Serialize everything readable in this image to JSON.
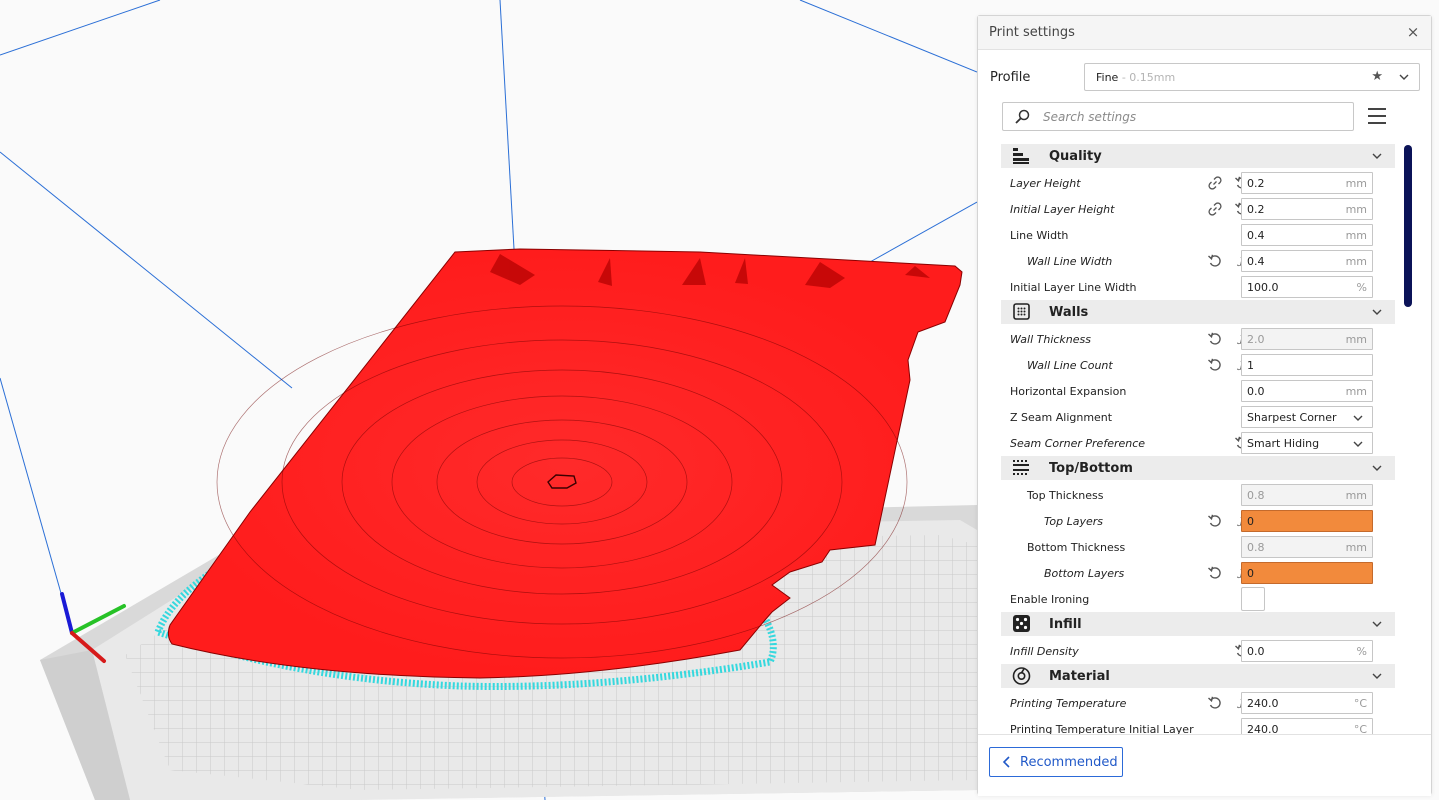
{
  "panel": {
    "title": "Print settings",
    "close_glyph": "×",
    "profile_label": "Profile",
    "profile_name": "Fine",
    "profile_detail": " - 0.15mm",
    "search_placeholder": "Search settings",
    "footer_button": "Recommended"
  },
  "icons": {
    "quality": "quality-icon",
    "walls": "walls-icon",
    "top_bottom": "top-bottom-icon",
    "infill": "infill-icon",
    "material": "material-icon",
    "link": "link-icon",
    "reset": "reset-icon",
    "function": "function-icon"
  },
  "categories": {
    "quality": "Quality",
    "walls": "Walls",
    "top_bottom": "Top/Bottom",
    "infill": "Infill",
    "material": "Material"
  },
  "settings": {
    "layer_height": {
      "label": "Layer Height",
      "value": "0.2",
      "unit": "mm"
    },
    "initial_layer_height": {
      "label": "Initial Layer Height",
      "value": "0.2",
      "unit": "mm"
    },
    "line_width": {
      "label": "Line Width",
      "value": "0.4",
      "unit": "mm"
    },
    "wall_line_width": {
      "label": "Wall Line Width",
      "value": "0.4",
      "unit": "mm"
    },
    "initial_layer_line_width": {
      "label": "Initial Layer Line Width",
      "value": "100.0",
      "unit": "%"
    },
    "wall_thickness": {
      "label": "Wall Thickness",
      "value": "2.0",
      "unit": "mm"
    },
    "wall_line_count": {
      "label": "Wall Line Count",
      "value": "1"
    },
    "horizontal_expansion": {
      "label": "Horizontal Expansion",
      "value": "0.0",
      "unit": "mm"
    },
    "z_seam_alignment": {
      "label": "Z Seam Alignment",
      "value": "Sharpest Corner"
    },
    "seam_corner_preference": {
      "label": "Seam Corner Preference",
      "value": "Smart Hiding"
    },
    "top_thickness": {
      "label": "Top Thickness",
      "value": "0.8",
      "unit": "mm"
    },
    "top_layers": {
      "label": "Top Layers",
      "value": "0"
    },
    "bottom_thickness": {
      "label": "Bottom Thickness",
      "value": "0.8",
      "unit": "mm"
    },
    "bottom_layers": {
      "label": "Bottom Layers",
      "value": "0"
    },
    "enable_ironing": {
      "label": "Enable Ironing",
      "checked": false
    },
    "infill_density": {
      "label": "Infill Density",
      "value": "0.0",
      "unit": "%"
    },
    "printing_temperature": {
      "label": "Printing Temperature",
      "value": "240.0",
      "unit": "°C"
    },
    "printing_temperature_initial_layer": {
      "label": "Printing Temperature Initial Layer",
      "value": "240.0",
      "unit": "°C"
    }
  },
  "colors": {
    "model": "#ff1c1c",
    "skirt": "#35d8de",
    "warning_field": "#f28a3c",
    "accent": "#2159c8",
    "scrollbar": "#0b1358"
  }
}
